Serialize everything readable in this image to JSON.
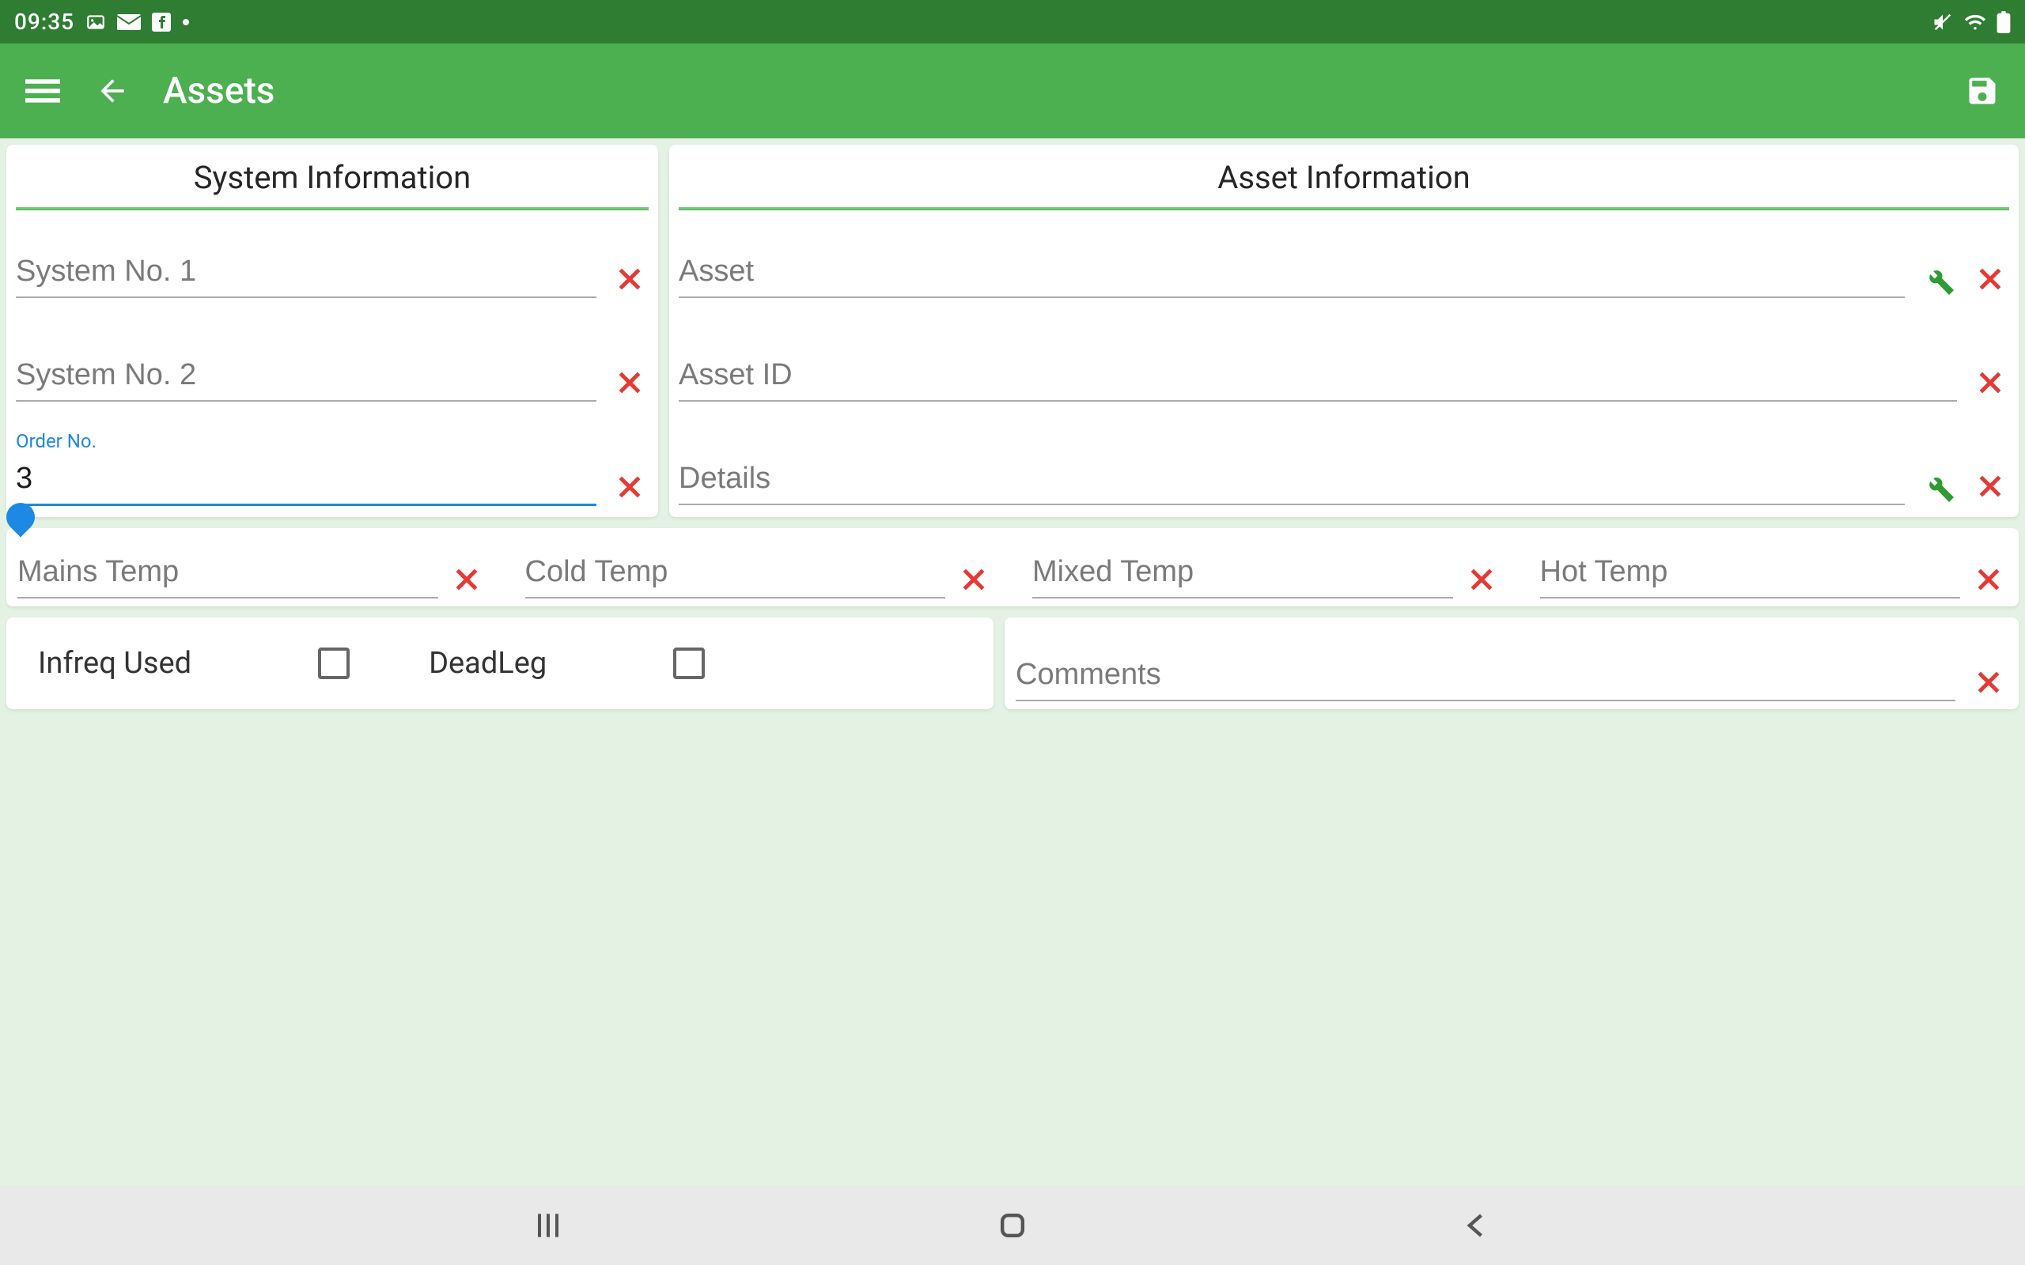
{
  "status": {
    "time": "09:35",
    "left_icons": [
      "image-icon",
      "mail-icon",
      "facebook-icon",
      "dot-icon"
    ],
    "right_icons": [
      "mute-icon",
      "wifi-icon",
      "battery-icon"
    ]
  },
  "appbar": {
    "title": "Assets"
  },
  "system_info": {
    "heading": "System Information",
    "fields": {
      "system_1": {
        "placeholder": "System No. 1",
        "value": ""
      },
      "system_2": {
        "placeholder": "System No. 2",
        "value": ""
      },
      "order_no": {
        "label": "Order No.",
        "value": "3"
      }
    }
  },
  "asset_info": {
    "heading": "Asset Information",
    "fields": {
      "asset": {
        "placeholder": "Asset",
        "value": ""
      },
      "asset_id": {
        "placeholder": "Asset ID",
        "value": ""
      },
      "details": {
        "placeholder": "Details",
        "value": ""
      }
    }
  },
  "temps": {
    "mains": {
      "placeholder": "Mains Temp",
      "value": ""
    },
    "cold": {
      "placeholder": "Cold Temp",
      "value": ""
    },
    "mixed": {
      "placeholder": "Mixed Temp",
      "value": ""
    },
    "hot": {
      "placeholder": "Hot Temp",
      "value": ""
    }
  },
  "checks": {
    "infreq_label": "Infreq Used",
    "infreq_checked": false,
    "deadleg_label": "DeadLeg",
    "deadleg_checked": false
  },
  "comments": {
    "placeholder": "Comments",
    "value": ""
  },
  "colors": {
    "status_bg": "#2f7d32",
    "appbar_bg": "#4caf50",
    "page_bg": "#e3f2e3",
    "danger": "#e53935",
    "accent_green": "#2e9b33",
    "focus_blue": "#1e88e5"
  }
}
